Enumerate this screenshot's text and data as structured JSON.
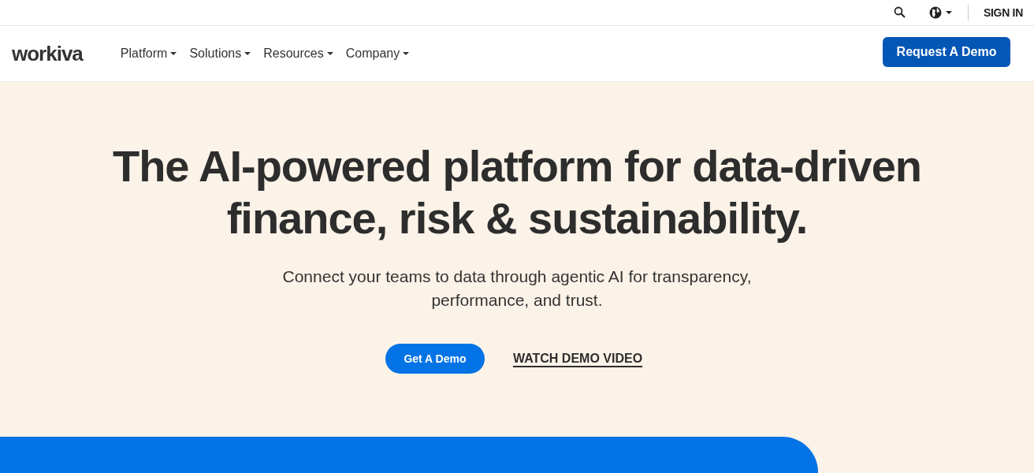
{
  "utility_bar": {
    "sign_in": "SIGN IN"
  },
  "nav": {
    "logo": "workiva",
    "items": [
      {
        "label": "Platform"
      },
      {
        "label": "Solutions"
      },
      {
        "label": "Resources"
      },
      {
        "label": "Company"
      }
    ],
    "cta": "Request A Demo"
  },
  "hero": {
    "headline": "The AI-powered platform for data-driven finance, risk & sustainability.",
    "subtitle": "Connect your teams to data through agentic AI for transparency, performance, and trust.",
    "primary_button": "Get A Demo",
    "secondary_link": "WATCH DEMO VIDEO"
  }
}
